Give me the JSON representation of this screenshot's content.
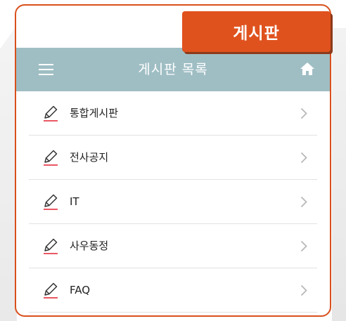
{
  "badge": {
    "label": "게시판"
  },
  "appbar": {
    "title": "게시판 목록",
    "menu_icon": "hamburger-menu-icon",
    "home_icon": "home-icon"
  },
  "colors": {
    "accent": "#e0521d",
    "appbar": "#9fbec4",
    "pencil_underline": "#e0202e"
  },
  "list": {
    "items": [
      {
        "label": "통합게시판",
        "icon": "pencil-icon"
      },
      {
        "label": "전사공지",
        "icon": "pencil-icon"
      },
      {
        "label": "IT",
        "icon": "pencil-icon"
      },
      {
        "label": "사우동정",
        "icon": "pencil-icon"
      },
      {
        "label": "FAQ",
        "icon": "pencil-icon"
      }
    ]
  }
}
